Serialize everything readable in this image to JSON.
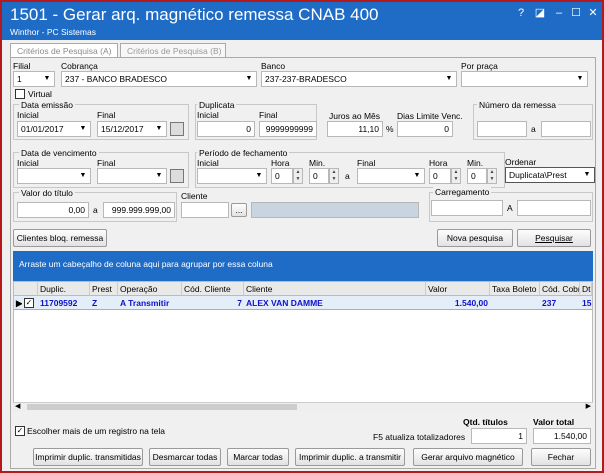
{
  "window": {
    "title": "1501 - Gerar arq. magnético remessa CNAB 400",
    "subtitle": "Winthor - PC Sistemas",
    "controls": [
      "?",
      "◪",
      "–",
      "☐",
      "✕"
    ]
  },
  "tabs": [
    "Critérios de Pesquisa (A)",
    "Critérios de Pesquisa (B)"
  ],
  "filters": {
    "filial_label": "Filial",
    "filial_value": "1",
    "cobranca_label": "Cobrança",
    "cobranca_value": "237 - BANCO BRADESCO",
    "banco_label": "Banco",
    "banco_value": "237-237-BRADESCO",
    "por_praca_label": "Por praça",
    "por_praca_value": "",
    "virtual_label": "Virtual",
    "data_emissao_label": "Data emissão",
    "inicial_label": "Inicial",
    "final_label": "Final",
    "emissao_inicial": "01/01/2017",
    "emissao_final": "15/12/2017",
    "duplicata_label": "Duplicata",
    "dup_inicial": "0",
    "dup_final": "9999999999",
    "juros_label": "Juros ao Mês",
    "juros_value": "11,10",
    "juros_unit": "%",
    "dias_label": "Dias Limite Venc.",
    "dias_value": "0",
    "remessa_label": "Número da remessa",
    "remessa_sep": "a",
    "vencimento_label": "Data de vencimento",
    "periodo_label": "Período de fechamento",
    "hora_label": "Hora",
    "min_label": "Min.",
    "hora_ini": "0",
    "min_ini": "0",
    "hora_fim": "0",
    "min_fim": "0",
    "periodo_sep": "a",
    "ordenar_label": "Ordenar",
    "ordenar_value": "Duplicata\\Prest",
    "valor_label": "Valor do título",
    "valor_ini": "0,00",
    "valor_sep": "a",
    "valor_fim": "999.999.999,00",
    "cliente_label": "Cliente",
    "cliente_btn": "...",
    "carregamento_label": "Carregamento",
    "carregamento_sep": "A"
  },
  "actions": {
    "clientes_bloq": "Clientes bloq. remessa",
    "nova_pesquisa": "Nova pesquisa",
    "pesquisar": "Pesquisar"
  },
  "grid": {
    "group_hint": "Arraste um cabeçalho de coluna aqui para agrupar por essa coluna",
    "columns": [
      "Duplic.",
      "Prest",
      "Operação",
      "Cód. Cliente",
      "Cliente",
      "Valor",
      "Taxa Boleto",
      "Cód. Cobran",
      "Dt"
    ],
    "rows": [
      [
        "11709592",
        "Z",
        "A Transmitir",
        "7",
        "ALEX VAN DAMME",
        "1.540,00",
        "",
        "237",
        "15"
      ]
    ]
  },
  "footer": {
    "multi_select_label": "Escolher mais de um registro na tela",
    "f5_label": "F5 atualiza totalizadores",
    "qtd_label": "Qtd. títulos",
    "qtd_value": "1",
    "total_label": "Valor total",
    "total_value": "1.540,00",
    "buttons": [
      "Imprimir duplic. transmitidas",
      "Desmarcar todas",
      "Marcar todas",
      "Imprimir duplic. a transmitir",
      "Gerar arquivo magnético",
      "Fechar"
    ]
  },
  "colors": {
    "titlebar": "#1f6cc7",
    "row_text": "#1010c8",
    "border": "#b4191c"
  }
}
